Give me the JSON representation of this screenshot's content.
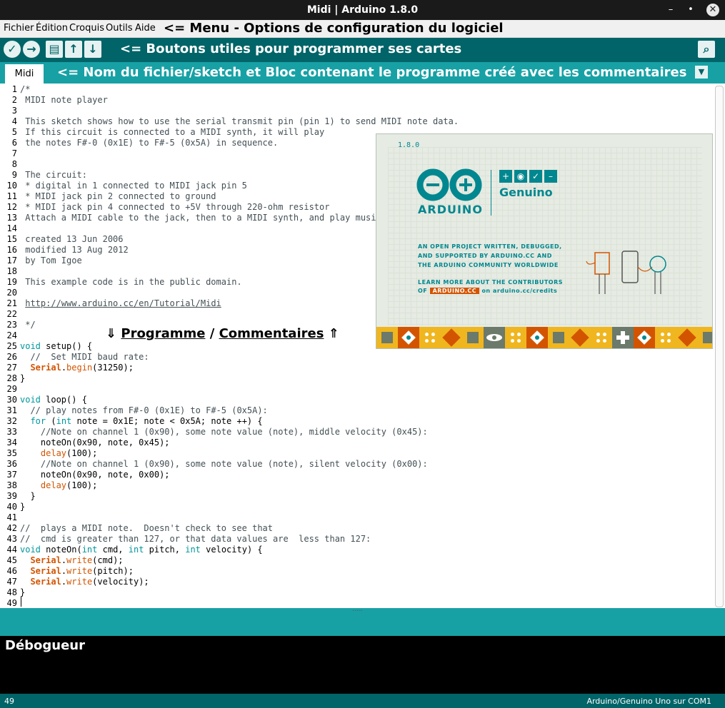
{
  "window": {
    "title": "Midi | Arduino 1.8.0",
    "min": "–",
    "max": "•",
    "close": "✕"
  },
  "menu": {
    "items": [
      "Fichier",
      "Édition",
      "Croquis",
      "Outils",
      "Aide"
    ],
    "annotation": "<= Menu - Options de configuration du logiciel"
  },
  "toolbar": {
    "annotation": "<= Boutons utiles pour programmer ses cartes",
    "icons": [
      "verify-icon",
      "upload-icon",
      "new-icon",
      "open-icon",
      "save-icon",
      "serial-monitor-icon"
    ]
  },
  "tabs": {
    "active": "Midi",
    "annotation": "<= Nom du fichier/sketch et Bloc contenant le programme créé avec les commentaires",
    "dropdown": "▼"
  },
  "editor": {
    "lines": [
      "/*",
      " MIDI note player",
      "",
      " This sketch shows how to use the serial transmit pin (pin 1) to send MIDI note data.",
      " If this circuit is connected to a MIDI synth, it will play",
      " the notes F#-0 (0x1E) to F#-5 (0x5A) in sequence.",
      "",
      "",
      " The circuit:",
      " * digital in 1 connected to MIDI jack pin 5",
      " * MIDI jack pin 2 connected to ground",
      " * MIDI jack pin 4 connected to +5V through 220-ohm resistor",
      " Attach a MIDI cable to the jack, then to a MIDI synth, and play music.",
      "",
      " created 13 Jun 2006",
      " modified 13 Aug 2012",
      " by Tom Igoe",
      "",
      " This example code is in the public domain.",
      "",
      " http://www.arduino.cc/en/Tutorial/Midi",
      "",
      " */",
      "",
      "void setup() {",
      "  //  Set MIDI baud rate:",
      "  Serial.begin(31250);",
      "}",
      "",
      "void loop() {",
      "  // play notes from F#-0 (0x1E) to F#-5 (0x5A):",
      "  for (int note = 0x1E; note < 0x5A; note ++) {",
      "    //Note on channel 1 (0x90), some note value (note), middle velocity (0x45):",
      "    noteOn(0x90, note, 0x45);",
      "    delay(100);",
      "    //Note on channel 1 (0x90), some note value (note), silent velocity (0x00):",
      "    noteOn(0x90, note, 0x00);",
      "    delay(100);",
      "  }",
      "}",
      "",
      "//  plays a MIDI note.  Doesn't check to see that",
      "//  cmd is greater than 127, or that data values are  less than 127:",
      "void noteOn(int cmd, int pitch, int velocity) {",
      "  Serial.write(cmd);",
      "  Serial.write(pitch);",
      "  Serial.write(velocity);",
      "}",
      ""
    ],
    "annotation": {
      "arrow_down": "⇓",
      "prog": "Programme",
      "sep": "/",
      "comm": "Commentaires",
      "arrow_up": "⇑"
    }
  },
  "splash": {
    "version": "1.8.0",
    "brand": "ARDUINO",
    "genuino": "Genuino",
    "line1": "AN OPEN PROJECT WRITTEN, DEBUGGED,",
    "line2": "AND SUPPORTED BY ARDUINO.CC AND",
    "line3": "THE ARDUINO COMMUNITY WORLDWIDE",
    "line4": "LEARN MORE ABOUT THE CONTRIBUTORS",
    "of": "OF",
    "badge": "ARDUINO.CC",
    "credits": "on arduino.cc/credits"
  },
  "divider": ".....",
  "console": {
    "label": "Débogueur"
  },
  "status": {
    "line": "49",
    "board": "Arduino/Genuino Uno sur COM1"
  },
  "colors": {
    "teal_dark": "#006468",
    "teal": "#17a1a5",
    "keyword": "#00979c",
    "function": "#d35400"
  }
}
